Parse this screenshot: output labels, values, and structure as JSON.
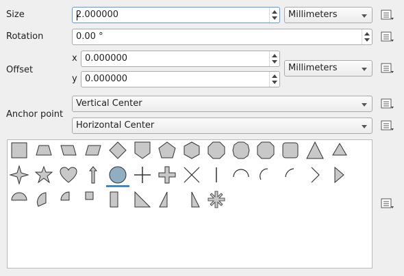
{
  "size": {
    "label": "Size",
    "value": "2.000000",
    "unit": "Millimeters"
  },
  "rotation": {
    "label": "Rotation",
    "value": "0.00 °"
  },
  "offset": {
    "label": "Offset",
    "x_label": "x",
    "x_value": "0.000000",
    "y_label": "y",
    "y_value": "0.000000",
    "unit": "Millimeters"
  },
  "anchor": {
    "label": "Anchor point",
    "vertical": "Vertical Center",
    "horizontal": "Horizontal Center"
  },
  "shapes": {
    "selected": "circle",
    "row1": [
      "square",
      "trapezoid",
      "parallelogram-right",
      "parallelogram-left",
      "diamond",
      "shield",
      "pentagon",
      "hexagon",
      "octagon",
      "decagon",
      "rounded-octagon",
      "rounded-square",
      "triangle",
      "equilateral-triangle"
    ],
    "row2": [
      "four-point-star",
      "star",
      "heart",
      "arrow",
      "circle",
      "cross",
      "cross-fill",
      "x-cross",
      "line",
      "semicircle-arc",
      "third-arc",
      "quarter-arc",
      "arrow-head",
      "filled-arrow-head"
    ],
    "row3": [
      "semicircle",
      "third-circle",
      "quarter-circle",
      "quarter-square",
      "half-square",
      "diagonal-half-square",
      "right-half-triangle",
      "left-half-triangle",
      "asterisk-fill"
    ]
  },
  "colors": {
    "fill": "#c8c8c8",
    "selected_fill": "#90aec2",
    "stroke": "#303030",
    "selection": "#3d88c4"
  }
}
